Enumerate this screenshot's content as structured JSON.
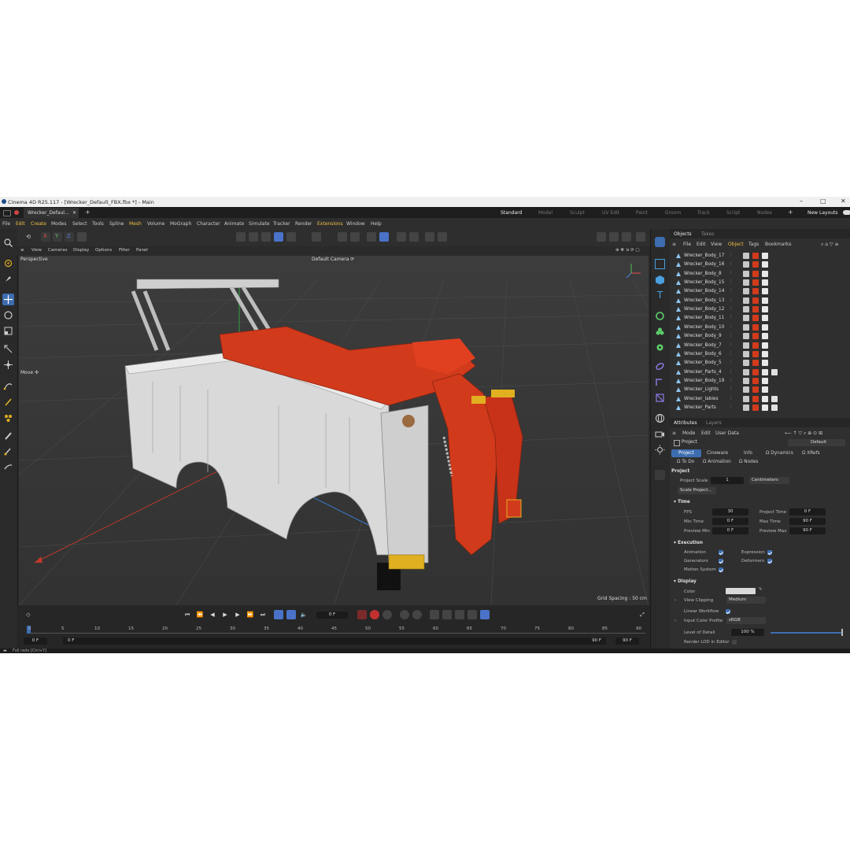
{
  "window": {
    "title": "Cinema 4D R25.117 - [Wrecker_Default_FBX.fbx *] - Main",
    "minimize": "–",
    "maximize": "□",
    "close": "✕"
  },
  "tabs": {
    "doc_tab": "Wrecker_Defaul...",
    "doc_close": "✕",
    "add": "+",
    "layouts": [
      "Standard",
      "Model",
      "Sculpt",
      "UV Edit",
      "Paint",
      "Groom",
      "Track",
      "Script",
      "Nodes"
    ],
    "new_layouts": "New Layouts"
  },
  "menu": [
    "File",
    "Edit",
    "Create",
    "Modes",
    "Select",
    "Tools",
    "Spline",
    "Mesh",
    "Volume",
    "MoGraph",
    "Character",
    "Animate",
    "Simulate",
    "Tracker",
    "Render",
    "Extensions",
    "Window",
    "Help"
  ],
  "axis": {
    "x": "X",
    "y": "Y",
    "z": "Z"
  },
  "viewport": {
    "menu": [
      "View",
      "Cameras",
      "Display",
      "Options",
      "Filter",
      "Panel"
    ],
    "name": "Perspective",
    "camera": "Default Camera ⟳",
    "tool_hint": "Move ✣",
    "grid_spacing": "Grid Spacing : 50 cm"
  },
  "timeline": {
    "current_frame": "0 F",
    "start": "0 F",
    "start2": "0 F",
    "end": "90 F",
    "end2": "90 F",
    "ticks": [
      "0",
      "5",
      "10",
      "15",
      "20",
      "25",
      "30",
      "35",
      "40",
      "45",
      "50",
      "55",
      "60",
      "65",
      "70",
      "75",
      "80",
      "85",
      "90"
    ]
  },
  "status": "Full redo [Ctrl+Y]",
  "objects": {
    "tabs": [
      "Objects",
      "Takes"
    ],
    "menu": [
      "File",
      "Edit",
      "View",
      "Object",
      "Tags",
      "Bookmarks"
    ],
    "items": [
      "Wrecker_Body_17",
      "Wrecker_Body_16",
      "Wrecker_Body_8",
      "Wrecker_Body_15",
      "Wrecker_Body_14",
      "Wrecker_Body_13",
      "Wrecker_Body_12",
      "Wrecker_Body_11",
      "Wrecker_Body_10",
      "Wrecker_Body_9",
      "Wrecker_Body_7",
      "Wrecker_Body_6",
      "Wrecker_Body_5",
      "Wrecker_Parts_4",
      "Wrecker_Body_19",
      "Wrecker_Lights",
      "Wrecker_labies",
      "Wrecker_Parts"
    ]
  },
  "attributes": {
    "tabs": [
      "Attributes",
      "Layers"
    ],
    "menu": [
      "Mode",
      "Edit",
      "User Data"
    ],
    "object_label": "Project",
    "preset": "Default",
    "section_tabs_row1": [
      "Project",
      "Cineware",
      "Info",
      "Ω Dynamics",
      "Ω XRefs"
    ],
    "section_tabs_row2": [
      "Ω To Do",
      "Ω Animation",
      "Ω Nodes"
    ],
    "project_header": "Project",
    "project_scale_label": "Project Scale",
    "project_scale_value": "1",
    "project_scale_unit": "Centimeters",
    "scale_project_btn": "Scale Project...",
    "time_header": "Time",
    "fps_label": "FPS",
    "fps_value": "30",
    "project_time_label": "Project Time",
    "project_time_value": "0 F",
    "min_time_label": "Min Time",
    "min_time_value": "0 F",
    "max_time_label": "Max Time",
    "max_time_value": "90 F",
    "preview_min_label": "Preview Min",
    "preview_min_value": "0 F",
    "preview_max_label": "Preview Max",
    "preview_max_value": "90 F",
    "execution_header": "Execution",
    "animation_label": "Animation",
    "expression_label": "Expression",
    "generators_label": "Generators",
    "deformers_label": "Deformers",
    "motion_system_label": "Motion System",
    "display_header": "Display",
    "color_label": "Color",
    "view_clipping_label": "View Clipping",
    "view_clipping_value": "Medium",
    "linear_workflow_label": "Linear Workflow",
    "input_color_profile_label": "Input Color Profile",
    "input_color_profile_value": "sRGB",
    "level_of_detail_label": "Level of Detail",
    "level_of_detail_value": "100 %",
    "render_lod_label": "Render LOD in Editor"
  },
  "colors": {
    "accent_blue": "#3d6db0",
    "truck_red": "#d23a1c",
    "truck_white": "#d8d8d8",
    "yellow": "#e0b020"
  }
}
